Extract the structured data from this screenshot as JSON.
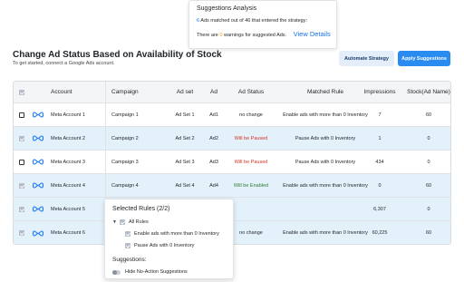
{
  "analysis": {
    "title": "Suggestions Analysis",
    "matched_count": "6",
    "matched_text": "Ads matched out of 46 that entered the strategy:",
    "warn_prefix": "There are",
    "warn_count": "0",
    "warn_suffix": "warnings for suggested Ads.",
    "view_details": "View Details"
  },
  "header": {
    "title": "Change Ad Status Based on Availability of Stock",
    "subtitle": "To get started, connect a Google Ads account.",
    "automate_label": "Automate Strategy",
    "apply_label": "Apply Suggestions"
  },
  "table": {
    "columns": {
      "account": "Account",
      "campaign": "Campaign",
      "adset": "Ad set",
      "ad": "Ad",
      "status": "Ad Status",
      "rule": "Matched Rule",
      "impressions": "Impressions",
      "stock": "Stock(Ad Name)"
    },
    "rows": [
      {
        "account": "Meta Account 1",
        "campaign": "Campaign 1",
        "adset": "Ad Set 1",
        "ad": "Ad1",
        "status": "no change",
        "rule": "Enable ads with more than 0 Inventory",
        "impressions": "7",
        "stock": "60"
      },
      {
        "account": "Meta Account 2",
        "campaign": "Campaign 2",
        "adset": "Ad Set 2",
        "ad": "Ad2",
        "status": "Will be Paused",
        "rule": "Pause Ads with 0 Inventory",
        "impressions": "1",
        "stock": "0"
      },
      {
        "account": "Meta Account 3",
        "campaign": "Campaign 3",
        "adset": "Ad Set 3",
        "ad": "Ad3",
        "status": "Will be Paused",
        "rule": "Pause Ads with 0 Inventory",
        "impressions": "434",
        "stock": "0"
      },
      {
        "account": "Meta Account 4",
        "campaign": "Campaign 4",
        "adset": "Ad Set 4",
        "ad": "Ad4",
        "status": "Will be Enabled",
        "rule": "Enable ads with more than 0 Inventory",
        "impressions": "0",
        "stock": "60"
      },
      {
        "account": "Meta Account 5",
        "campaign": "",
        "adset": "",
        "ad": "",
        "status": "",
        "rule": "",
        "impressions": "6,307",
        "stock": "0"
      },
      {
        "account": "Meta Account 6",
        "campaign": "",
        "adset": "",
        "ad": "",
        "status": "no change",
        "rule": "Enable ads with more than 0 Inventory",
        "impressions": "60,225",
        "stock": "60"
      }
    ]
  },
  "dropdown": {
    "title": "Selected Rules (2/2)",
    "all_rules": "All Rules",
    "rule1": "Enable ads with more than 0 Inventory",
    "rule2": "Pause Ads with 0 Inventory",
    "suggestions_label": "Suggestions:",
    "hide_label": "Hide No-Action Suggestions"
  },
  "colors": {
    "accent": "#2a8cf0",
    "selected_row": "#e3f1fb",
    "paused": "#d93025",
    "enabled": "#2e7d32",
    "warning": "#f29900"
  }
}
